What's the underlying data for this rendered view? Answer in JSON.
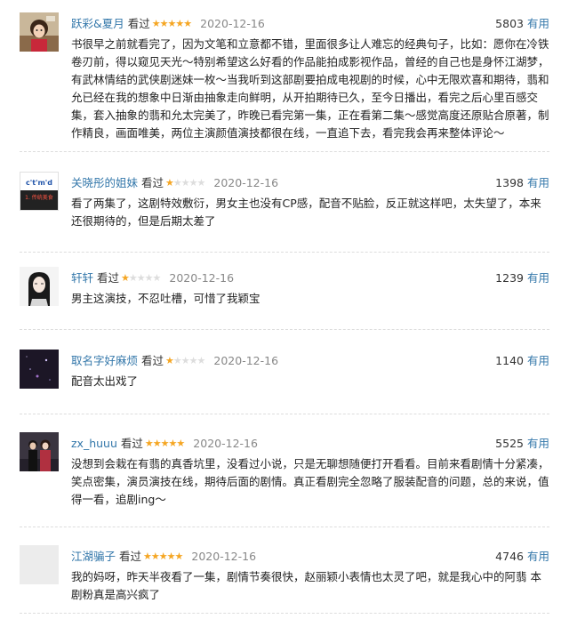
{
  "reviews": [
    {
      "username": "跃彩&夏月",
      "watched": "看过",
      "rating": 5,
      "date": "2020-12-16",
      "votes": "5803",
      "useful_label": "有用",
      "content": "书很早之前就看完了，因为文笔和立意都不错，里面很多让人难忘的经典句子，比如：愿你在冷铁卷刃前，得以窥见天光～特别希望这么好看的作品能拍成影视作品，曾经的自己也是身怀江湖梦，有武林情结的武侠剧迷妹一枚～当我听到这部剧要拍成电视剧的时候，心中无限欢喜和期待，翡和允已经在我的想象中日渐由抽象走向鲜明，从开拍期待已久，至今日播出，看完之后心里百感交集，套入抽象的翡和允太完美了，昨晚已看完第一集，正在看第二集～感觉高度还原贴合原著，制作精良，画面唯美，两位主演颜值演技都很在线，一直追下去，看完我会再来整体评论～",
      "avatar": "anime-girl-avatar"
    },
    {
      "username": "关晓彤的姐妹",
      "watched": "看过",
      "rating": 1,
      "date": "2020-12-16",
      "votes": "1398",
      "useful_label": "有用",
      "content": "看了两集了，这剧特效敷衍，男女主也没有CP感，配音不贴脸，反正就这样吧，太失望了，本来还很期待的，但是后期太差了",
      "avatar": "text-avatar",
      "avatar_text": [
        "c't'm'd",
        "1. 传统美食"
      ]
    },
    {
      "username": "轩轩",
      "watched": "看过",
      "rating": 1,
      "date": "2020-12-16",
      "votes": "1239",
      "useful_label": "有用",
      "content": "男主这演技，不忍吐槽，可惜了我颖宝",
      "avatar": "long-hair-avatar"
    },
    {
      "username": "取名字好麻烦",
      "watched": "看过",
      "rating": 1,
      "date": "2020-12-16",
      "votes": "1140",
      "useful_label": "有用",
      "content": "配音太出戏了",
      "avatar": "dark-night-avatar"
    },
    {
      "username": "zx_huuu",
      "watched": "看过",
      "rating": 5,
      "date": "2020-12-16",
      "votes": "5525",
      "useful_label": "有用",
      "content": "没想到会栽在有翡的真香坑里，没看过小说，只是无聊想随便打开看看。目前来看剧情十分紧凑，笑点密集，演员演技在线，期待后面的剧情。真正看剧完全忽略了服装配音的问题，总的来说，值得一看，追剧ing～",
      "avatar": "couple-photo-avatar"
    },
    {
      "username": "江湖骗子",
      "watched": "看过",
      "rating": 5,
      "date": "2020-12-16",
      "votes": "4746",
      "useful_label": "有用",
      "content": "我的妈呀，昨天半夜看了一集，剧情节奏很快，赵丽颖小表情也太灵了吧，就是我心中的阿翡 本剧粉真是高兴疯了",
      "avatar": "blank-avatar"
    }
  ],
  "colors": {
    "link": "#3377aa",
    "star_on": "#f5a623",
    "star_off": "#dddddd",
    "date": "#888888",
    "divider": "#dddddd"
  },
  "icons": {
    "star_filled": "★",
    "star_empty": "★"
  }
}
